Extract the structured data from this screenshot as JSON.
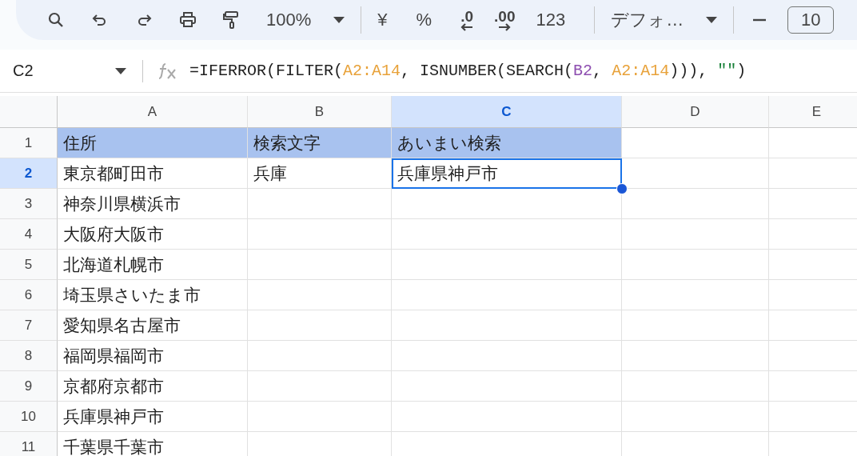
{
  "toolbar": {
    "items": [
      {
        "kind": "icon"
      },
      {
        "kind": "icon"
      },
      {
        "kind": "icon"
      },
      {
        "kind": "icon"
      },
      {
        "kind": "icon"
      },
      {
        "kind": "dropdown",
        "label": "100%"
      },
      {
        "kind": "separator"
      },
      {
        "kind": "text",
        "label": "¥"
      },
      {
        "kind": "text",
        "label": "%"
      },
      {
        "kind": "decimal",
        "label": ".0"
      },
      {
        "kind": "decimal",
        "label": ".00"
      },
      {
        "kind": "text",
        "label": "123"
      },
      {
        "kind": "separator"
      },
      {
        "kind": "dropdown",
        "label": "デフォ…"
      },
      {
        "kind": "separator"
      },
      {
        "kind": "icon"
      },
      {
        "kind": "field",
        "label": "10"
      }
    ]
  },
  "formula_bar": {
    "cell_ref": "C2",
    "formula": [
      {
        "text": "=IFERROR(FILTER(",
        "kind": "plain"
      },
      {
        "text": "A2:A14",
        "kind": "range1"
      },
      {
        "text": ", ISNUMBER(SEARCH(",
        "kind": "plain"
      },
      {
        "text": "B2",
        "kind": "range2"
      },
      {
        "text": ", ",
        "kind": "plain"
      },
      {
        "text": "A2:A14",
        "kind": "range1"
      },
      {
        "text": "))), ",
        "kind": "plain"
      },
      {
        "text": "\"\"",
        "kind": "string"
      },
      {
        "text": ")",
        "kind": "plain"
      }
    ]
  },
  "columns": [
    {
      "label": "A",
      "selected": false
    },
    {
      "label": "B",
      "selected": false
    },
    {
      "label": "C",
      "selected": true
    },
    {
      "label": "D",
      "selected": false
    },
    {
      "label": "E",
      "selected": false
    }
  ],
  "rows": [
    {
      "number": "1",
      "selected": false,
      "cells": [
        {
          "text": "住所",
          "filled": true,
          "selected": false
        },
        {
          "text": "検索文字",
          "filled": true,
          "selected": false
        },
        {
          "text": "あいまい検索",
          "filled": true,
          "selected": false
        }
      ]
    },
    {
      "number": "2",
      "selected": true,
      "cells": [
        {
          "text": "東京都町田市",
          "filled": false,
          "selected": false
        },
        {
          "text": "兵庫",
          "filled": false,
          "selected": false
        },
        {
          "text": "兵庫県神戸市",
          "filled": false,
          "selected": true
        }
      ]
    },
    {
      "number": "3",
      "selected": false,
      "cells": [
        {
          "text": "神奈川県横浜市",
          "filled": false,
          "selected": false
        }
      ]
    },
    {
      "number": "4",
      "selected": false,
      "cells": [
        {
          "text": "大阪府大阪市",
          "filled": false,
          "selected": false
        }
      ]
    },
    {
      "number": "5",
      "selected": false,
      "cells": [
        {
          "text": "北海道札幌市",
          "filled": false,
          "selected": false
        }
      ]
    },
    {
      "number": "6",
      "selected": false,
      "cells": [
        {
          "text": "埼玉県さいたま市",
          "filled": false,
          "selected": false
        }
      ]
    },
    {
      "number": "7",
      "selected": false,
      "cells": [
        {
          "text": "愛知県名古屋市",
          "filled": false,
          "selected": false
        }
      ]
    },
    {
      "number": "8",
      "selected": false,
      "cells": [
        {
          "text": "福岡県福岡市",
          "filled": false,
          "selected": false
        }
      ]
    },
    {
      "number": "9",
      "selected": false,
      "cells": [
        {
          "text": "京都府京都市",
          "filled": false,
          "selected": false
        }
      ]
    },
    {
      "number": "10",
      "selected": false,
      "cells": [
        {
          "text": "兵庫県神戸市",
          "filled": false,
          "selected": false
        }
      ]
    },
    {
      "number": "11",
      "selected": false,
      "cells": [
        {
          "text": "千葉県千葉市",
          "filled": false,
          "selected": false
        }
      ]
    }
  ]
}
